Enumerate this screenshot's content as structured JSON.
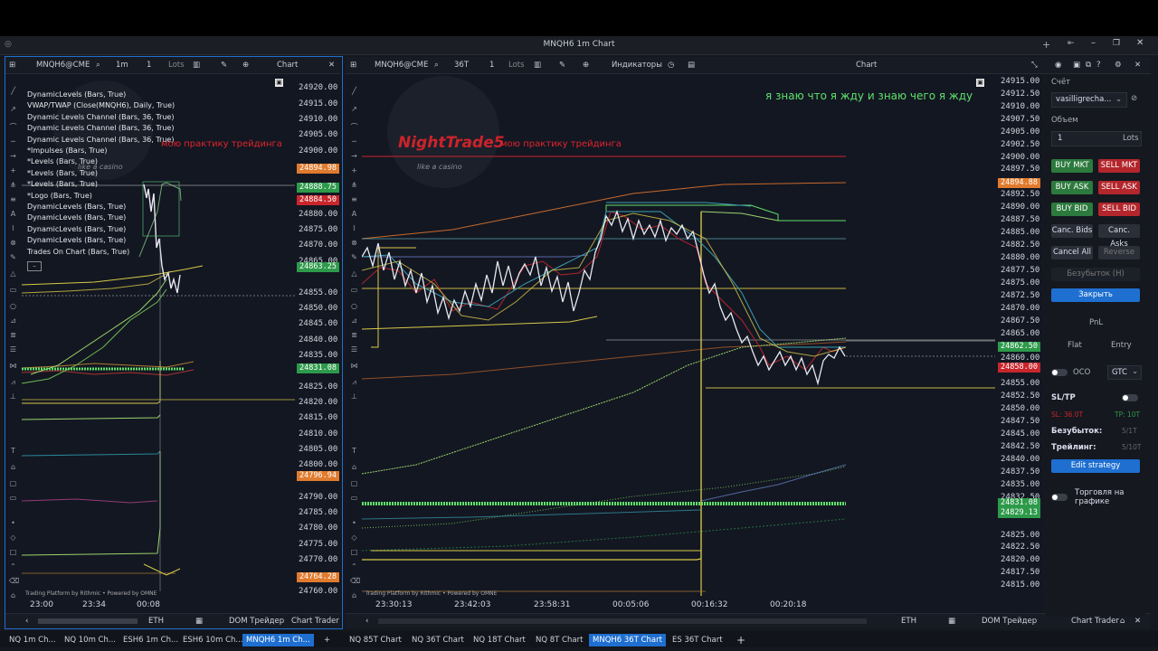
{
  "window": {
    "title": "MNQH6 1m Chart"
  },
  "left_chart": {
    "symbol": "MNQH6@CME",
    "timeframe": "1m",
    "quantity": "1",
    "lots_label": "Lots",
    "chart_label": "Chart",
    "indicators": [
      "DynamicLevels (Bars, True)",
      "VWAP/TWAP (Close(MNQH6), Daily, True)",
      "Dynamic Levels Channel (Bars, 36, True)",
      "Dynamic Levels Channel (Bars, 36, True)",
      "Dynamic Levels Channel (Bars, 36, True)",
      "*Impulses (Bars, True)",
      "*Levels (Bars, True)",
      "*Levels (Bars, True)",
      "*Levels (Bars, True)",
      "*Logo (Bars, True)",
      "DynamicLevels (Bars, True)",
      "DynamicLevels (Bars, True)",
      "DynamicLevels (Bars, True)",
      "DynamicLevels (Bars, True)",
      "Trades On Chart (Bars, True)"
    ],
    "y_ticks": [
      "24920.00",
      "24915.00",
      "24910.00",
      "24905.00",
      "24900.00",
      "24880.00",
      "24875.00",
      "24870.00",
      "24865.00",
      "24855.00",
      "24850.00",
      "24845.00",
      "24840.00",
      "24835.00",
      "24825.00",
      "24820.00",
      "24815.00",
      "24810.00",
      "24805.00",
      "24800.00",
      "24790.00",
      "24785.00",
      "24780.00",
      "24775.00",
      "24770.00",
      "24760.00"
    ],
    "price_labels": [
      {
        "value": "24894.98",
        "color": "#e07b2e"
      },
      {
        "value": "24888.75",
        "color": "#2d9a4a"
      },
      {
        "value": "24884.50",
        "color": "#c8262c"
      },
      {
        "value": "24863.25",
        "color": "#2d9a4a"
      },
      {
        "value": "24831.08",
        "color": "#2d9a4a"
      },
      {
        "value": "24796.94",
        "color": "#e07b2e"
      },
      {
        "value": "24764.28",
        "color": "#e07b2e"
      }
    ],
    "x_ticks": [
      "23:00",
      "23:34",
      "00:08"
    ],
    "overlay_text": "мою практику трейдинга",
    "logo_subtitle": "like a casino",
    "footer": "Trading Platform by Rithmic • Powered by OMNE",
    "bottom": {
      "session": "ETH",
      "dom": "DOM Трейдер",
      "chart_trader": "Chart Trader"
    }
  },
  "right_chart": {
    "symbol": "MNQH6@CME",
    "timeframe": "36T",
    "quantity": "1",
    "lots_label": "Lots",
    "indicators_label": "Индикаторы",
    "chart_label": "Chart",
    "annotation": "я знаю что я жду и знаю чего я жду",
    "overlay_text": "мою практику трейдинга",
    "logo_text": "NightTrade5",
    "logo_subtitle": "like a casino",
    "y_ticks": [
      "24915.00",
      "24912.50",
      "24910.00",
      "24907.50",
      "24905.00",
      "24902.50",
      "24900.00",
      "24897.50",
      "24892.50",
      "24890.00",
      "24887.50",
      "24885.00",
      "24882.50",
      "24880.00",
      "24877.50",
      "24875.00",
      "24872.50",
      "24870.00",
      "24867.50",
      "24865.00",
      "24860.00",
      "24855.00",
      "24852.50",
      "24850.00",
      "24847.50",
      "24845.00",
      "24842.50",
      "24840.00",
      "24837.50",
      "24835.00",
      "24832.50",
      "24825.00",
      "24822.50",
      "24820.00",
      "24817.50",
      "24815.00"
    ],
    "price_labels": [
      {
        "value": "24894.88",
        "color": "#e07b2e"
      },
      {
        "value": "24862.50",
        "color": "#2d9a4a"
      },
      {
        "value": "24858.00",
        "color": "#c8262c"
      },
      {
        "value": "24831.08",
        "color": "#2d9a4a"
      },
      {
        "value": "24829.13",
        "color": "#2d9a4a"
      }
    ],
    "x_ticks": [
      "23:30:13",
      "23:42:03",
      "23:58:31",
      "00:05:06",
      "00:16:32",
      "00:20:18"
    ],
    "footer": "Trading Platform by Rithmic • Powered by OMNE",
    "bottom": {
      "session": "ETH",
      "dom": "DOM Трейдер",
      "chart_trader": "Chart Trader"
    }
  },
  "trader": {
    "account_label": "Счёт",
    "account": "vasilligrecha...",
    "volume_label": "Объем",
    "volume": "1",
    "lots": "Lots",
    "buy_mkt": "BUY MKT",
    "sell_mkt": "SELL MKT",
    "buy_ask": "BUY ASK",
    "sell_ask": "SELL ASK",
    "buy_bid": "BUY BID",
    "sell_bid": "SELL BID",
    "canc_bids": "Canc. Bids",
    "canc_asks": "Canc. Asks",
    "cancel_all": "Cancel All",
    "reverse": "Reverse",
    "breakeven_h": "Безубыток (H)",
    "close": "Закрыть",
    "pnl": "PnL",
    "flat": "Flat",
    "entry": "Entry",
    "oco": "OCO",
    "tif": "GTC",
    "sltp": "SL/TP",
    "sl": "SL: 36.0T",
    "tp": "TP: 10T",
    "breakeven_label": "Безубыток:",
    "breakeven_val": "5/1T",
    "trailing_label": "Трейлинг:",
    "trailing_val": "5/10T",
    "edit_strategy": "Edit strategy",
    "chart_trading": "Торговля на графике"
  },
  "tabs": [
    "NQ 1m Ch...",
    "NQ 10m Ch...",
    "ESH6 1m Ch...",
    "ESH6 10m Ch...",
    "MNQH6 1m Ch...",
    "NQ 85T Chart",
    "NQ 36T Chart",
    "NQ 18T Chart",
    "NQ 8T Chart",
    "MNQH6 36T Chart",
    "ES 36T Chart",
    "+"
  ]
}
